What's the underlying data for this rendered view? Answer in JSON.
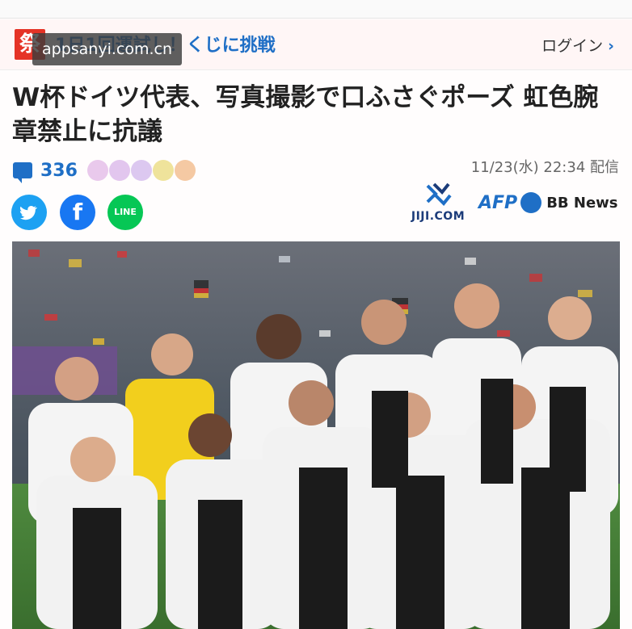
{
  "banner": {
    "logo_char": "祭",
    "promo_text": "1日1回運試し！くじに挑戦",
    "watermark": "appsanyi.com.cn",
    "login_label": "ログイン",
    "login_chevron": "›"
  },
  "article": {
    "headline": "W杯ドイツ代表、写真撮影で口ふさぐポーズ 虹色腕章禁止に抗議",
    "comment_count": "336",
    "date": "11/23(水) 22:34 配信"
  },
  "share": {
    "twitter_icon": "twitter-bird-icon",
    "facebook_glyph": "f",
    "line_glyph": "LINE"
  },
  "sources": {
    "jiji": "JIJI.COM",
    "afp": "AFP",
    "bbnews": "BB News"
  },
  "colors": {
    "accent_blue": "#1f6fc6",
    "logo_red": "#e53326",
    "twitter": "#1da1f2",
    "facebook": "#1877f2",
    "line": "#06c755"
  }
}
